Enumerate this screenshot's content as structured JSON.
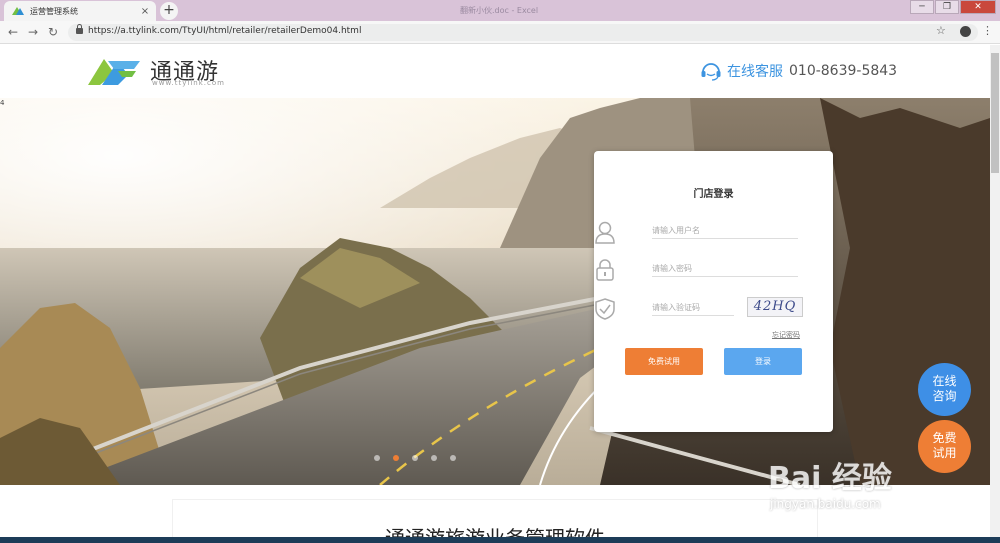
{
  "browser": {
    "tab_title": "运营管理系统",
    "tab_close": "×",
    "new_tab": "+",
    "ghost_title": "翻新小伙.doc - Excel",
    "window_controls": [
      "─",
      "❐",
      "✕"
    ],
    "nav": {
      "back": "←",
      "forward": "→",
      "reload": "↻"
    },
    "url": "https://a.ttylink.com/TtyUI/html/retailer/retailerDemo04.html",
    "star": "☆",
    "menu": "⋮"
  },
  "header": {
    "logo_name": "通通游",
    "logo_url": "www.ttylink.com",
    "service_label": "在线客服",
    "service_phone": "010-8639-5843"
  },
  "hero": {
    "slide_number": "4",
    "slides_count": 5,
    "active_slide": 2
  },
  "login": {
    "title": "门店登录",
    "username_placeholder": "请输入用户名",
    "password_placeholder": "请输入密码",
    "captcha_placeholder": "请输入验证码",
    "captcha_text": "42HQ",
    "forgot_label": "忘记密码",
    "trial_button": "免费试用",
    "login_button": "登录"
  },
  "floating": {
    "consult_line1": "在线",
    "consult_line2": "咨询",
    "trial_line1": "免费",
    "trial_line2": "试用"
  },
  "section": {
    "title": "通通游旅游业务管理软件"
  },
  "watermark": {
    "text": "Bai 经验",
    "url": "jingyan.baidu.com"
  },
  "colors": {
    "brand_blue": "#3d94e0",
    "brand_orange": "#ee7e35",
    "login_blue": "#5ba7ef"
  },
  "icons": {
    "user": "user-icon",
    "lock": "lock-icon",
    "shield": "shield-icon",
    "service": "headset-icon"
  }
}
